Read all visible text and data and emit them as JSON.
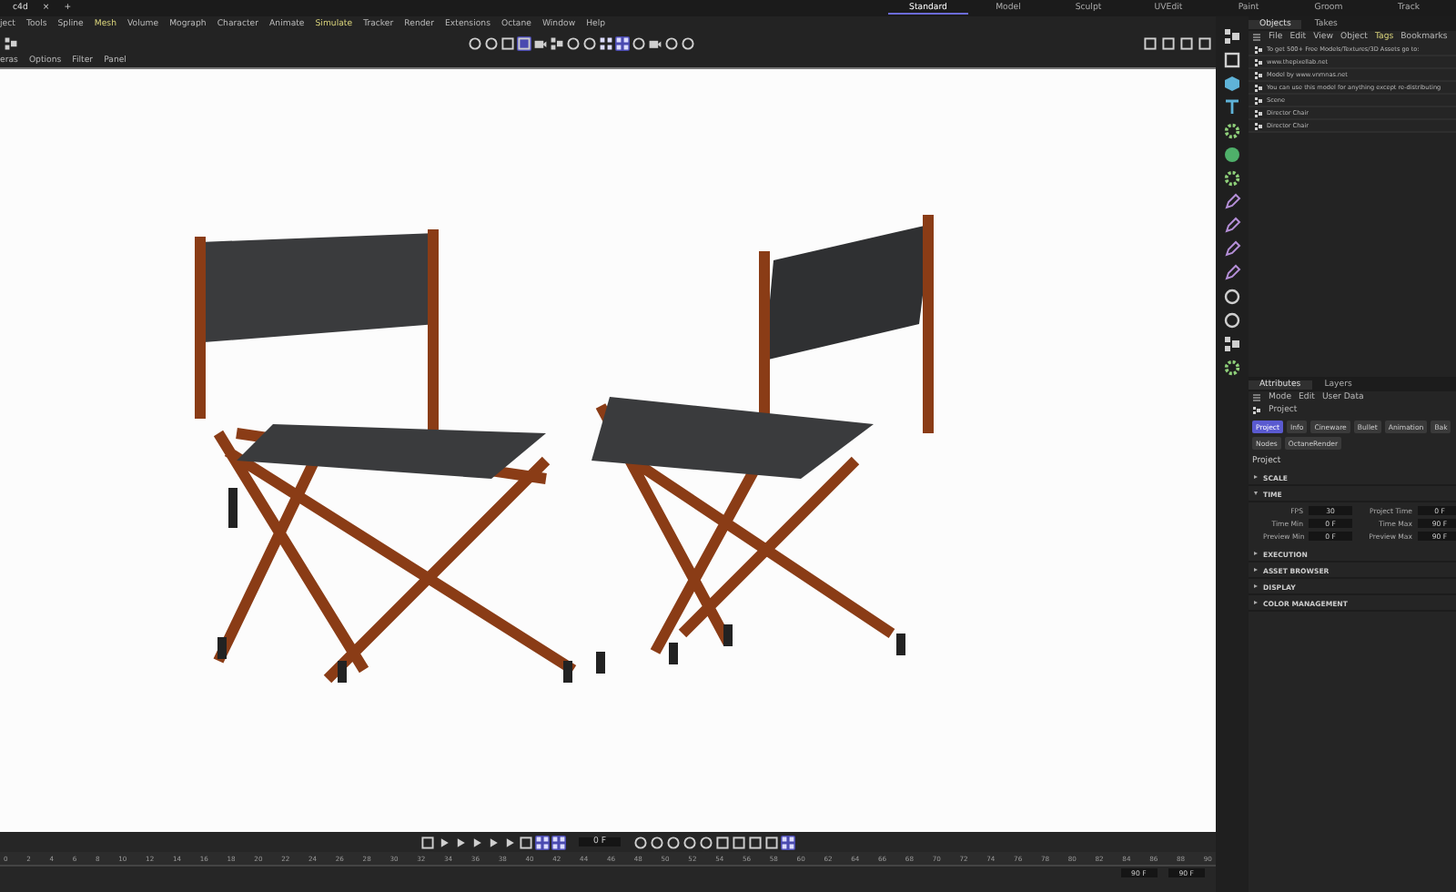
{
  "doc_tab": {
    "label": "c4d",
    "close": "×",
    "add": "+"
  },
  "menu": [
    {
      "label": "ject",
      "highlighted": false
    },
    {
      "label": "Tools",
      "highlighted": false
    },
    {
      "label": "Spline",
      "highlighted": false
    },
    {
      "label": "Mesh",
      "highlighted": true
    },
    {
      "label": "Volume",
      "highlighted": false
    },
    {
      "label": "Mograph",
      "highlighted": false
    },
    {
      "label": "Character",
      "highlighted": false
    },
    {
      "label": "Animate",
      "highlighted": false
    },
    {
      "label": "Simulate",
      "highlighted": true
    },
    {
      "label": "Tracker",
      "highlighted": false
    },
    {
      "label": "Render",
      "highlighted": false
    },
    {
      "label": "Extensions",
      "highlighted": false
    },
    {
      "label": "Octane",
      "highlighted": false
    },
    {
      "label": "Window",
      "highlighted": false
    },
    {
      "label": "Help",
      "highlighted": false
    }
  ],
  "layouts": [
    {
      "label": "Standard",
      "selected": true
    },
    {
      "label": "Model",
      "selected": false
    },
    {
      "label": "Sculpt",
      "selected": false
    },
    {
      "label": "UVEdit",
      "selected": false
    },
    {
      "label": "Paint",
      "selected": false
    },
    {
      "label": "Groom",
      "selected": false
    },
    {
      "label": "Track",
      "selected": false
    }
  ],
  "viewport_menu": [
    "eras",
    "Options",
    "Filter",
    "Panel"
  ],
  "objects_panel": {
    "tabs": [
      {
        "label": "Objects",
        "selected": true
      },
      {
        "label": "Takes",
        "selected": false
      }
    ],
    "menu": [
      {
        "label": "File",
        "highlighted": false
      },
      {
        "label": "Edit",
        "highlighted": false
      },
      {
        "label": "View",
        "highlighted": false
      },
      {
        "label": "Object",
        "highlighted": false
      },
      {
        "label": "Tags",
        "highlighted": true
      },
      {
        "label": "Bookmarks",
        "highlighted": false
      }
    ],
    "rows": [
      "To get 500+ Free Models/Textures/3D Assets go to:",
      "www.thepixellab.net",
      "Model by www.vnmnas.net",
      "You can use this model for anything except re-distributing",
      "Scene",
      "Director Chair",
      "Director Chair"
    ]
  },
  "attributes_panel": {
    "tabs": [
      {
        "label": "Attributes",
        "selected": true
      },
      {
        "label": "Layers",
        "selected": false
      }
    ],
    "menu": [
      "Mode",
      "Edit",
      "User Data"
    ],
    "object": "Project",
    "buttons": [
      {
        "label": "Project",
        "selected": true
      },
      {
        "label": "Info",
        "selected": false
      },
      {
        "label": "Cineware",
        "selected": false
      },
      {
        "label": "Bullet",
        "selected": false
      },
      {
        "label": "Animation",
        "selected": false
      },
      {
        "label": "Bak",
        "selected": false
      },
      {
        "label": "Nodes",
        "selected": false
      },
      {
        "label": "OctaneRender",
        "selected": false
      }
    ],
    "heading": "Project",
    "sections": [
      {
        "label": "SCALE",
        "expanded": false
      },
      {
        "label": "TIME",
        "expanded": true,
        "fields": [
          {
            "label": "FPS",
            "value": "30"
          },
          {
            "label": "Project Time",
            "value": "0 F"
          },
          {
            "label": "Time Min",
            "value": "0 F"
          },
          {
            "label": "Time Max",
            "value": "90 F"
          },
          {
            "label": "Preview Min",
            "value": "0 F"
          },
          {
            "label": "Preview Max",
            "value": "90 F"
          }
        ]
      },
      {
        "label": "EXECUTION",
        "expanded": false
      },
      {
        "label": "ASSET BROWSER",
        "expanded": false
      },
      {
        "label": "DISPLAY",
        "expanded": false
      },
      {
        "label": "COLOR MANAGEMENT",
        "expanded": false
      }
    ]
  },
  "timeline": {
    "frame": "0 F",
    "ruler": [
      "0",
      "2",
      "4",
      "6",
      "8",
      "10",
      "12",
      "14",
      "16",
      "18",
      "20",
      "22",
      "24",
      "26",
      "28",
      "30",
      "32",
      "34",
      "36",
      "38",
      "40",
      "42",
      "44",
      "46",
      "48",
      "50",
      "52",
      "54",
      "56",
      "58",
      "60",
      "62",
      "64",
      "66",
      "68",
      "70",
      "72",
      "74",
      "76",
      "78",
      "80",
      "82",
      "84",
      "86",
      "88",
      "90"
    ],
    "end_fields": [
      "90 F",
      "90 F"
    ]
  }
}
